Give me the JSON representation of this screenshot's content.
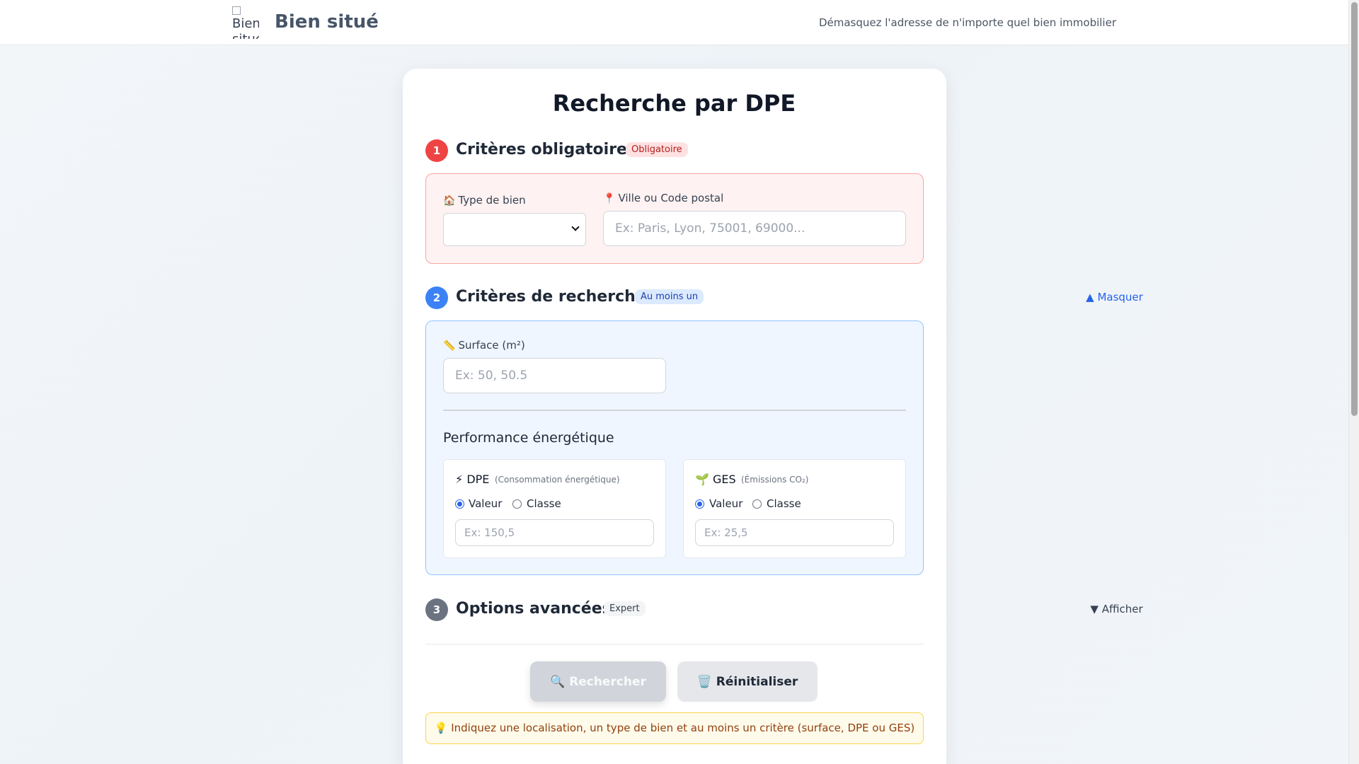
{
  "header": {
    "logo_alt": "Bien situé",
    "brand": "Bien situé",
    "tagline": "Démasquez l'adresse de n'importe quel bien immobilier"
  },
  "page": {
    "title": "Recherche par DPE"
  },
  "section1": {
    "number": "1",
    "title": "Critères obligatoires",
    "badge": "Obligatoire",
    "type_label_icon": "🏠",
    "type_label": "Type de bien",
    "type_value": "",
    "ville_label_icon": "📍",
    "ville_label": "Ville ou Code postal",
    "ville_placeholder": "Ex: Paris, Lyon, 75001, 69000..."
  },
  "section2": {
    "number": "2",
    "title": "Critères de recherche",
    "badge": "Au moins un",
    "toggle": "▲ Masquer",
    "surface_icon": "📏",
    "surface_label": "Surface (m²)",
    "surface_placeholder": "Ex: 50, 50.5",
    "perf_title": "Performance énergétique",
    "dpe": {
      "icon": "⚡",
      "title": "DPE",
      "hint": "(Consommation énergétique)",
      "opt_valeur": "Valeur",
      "opt_classe": "Classe",
      "placeholder": "Ex: 150,5"
    },
    "ges": {
      "icon": "🌱",
      "title": "GES",
      "hint": "(Émissions CO₂)",
      "opt_valeur": "Valeur",
      "opt_classe": "Classe",
      "placeholder": "Ex: 25,5"
    }
  },
  "section3": {
    "number": "3",
    "title": "Options avancées",
    "badge": "Expert",
    "toggle": "▼ Afficher"
  },
  "actions": {
    "search": "🔍 Rechercher",
    "reset": "🗑️ Réinitialiser"
  },
  "hint": "💡 Indiquez une localisation, un type de bien et au moins un critère (surface, DPE ou GES)"
}
